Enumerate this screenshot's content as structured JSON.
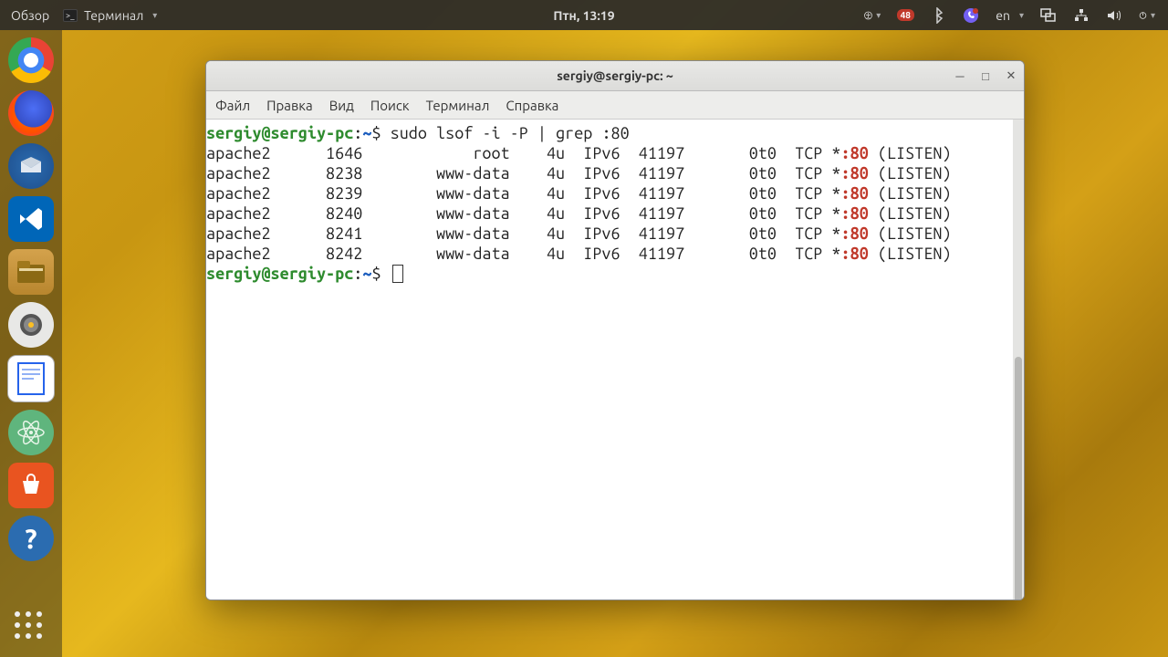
{
  "top_panel": {
    "activities": "Обзор",
    "app_menu": "Терминал",
    "clock": "Птн, 13:19",
    "lang": "en",
    "badge": "48"
  },
  "dock": {
    "items": [
      "chrome",
      "firefox",
      "thunderbird",
      "vscode",
      "files",
      "rhythmbox",
      "writer",
      "atom",
      "software",
      "help"
    ]
  },
  "window": {
    "title": "sergiy@sergiy-pc: ~",
    "menu": {
      "file": "Файл",
      "edit": "Правка",
      "view": "Вид",
      "search": "Поиск",
      "terminal": "Терминал",
      "help": "Справка"
    }
  },
  "terminal": {
    "prompt_user": "sergiy@sergiy-pc",
    "prompt_path": "~",
    "prompt_sep": ":",
    "prompt_dollar": "$",
    "command": "sudo lsof -i -P | grep :80",
    "rows": [
      {
        "proc": "apache2",
        "pid": "1646",
        "user": "root",
        "fd": "4u",
        "type": "IPv6",
        "node": "41197",
        "sz": "0t0",
        "proto": "TCP *",
        "port": ":80",
        "state": "(LISTEN)"
      },
      {
        "proc": "apache2",
        "pid": "8238",
        "user": "www-data",
        "fd": "4u",
        "type": "IPv6",
        "node": "41197",
        "sz": "0t0",
        "proto": "TCP *",
        "port": ":80",
        "state": "(LISTEN)"
      },
      {
        "proc": "apache2",
        "pid": "8239",
        "user": "www-data",
        "fd": "4u",
        "type": "IPv6",
        "node": "41197",
        "sz": "0t0",
        "proto": "TCP *",
        "port": ":80",
        "state": "(LISTEN)"
      },
      {
        "proc": "apache2",
        "pid": "8240",
        "user": "www-data",
        "fd": "4u",
        "type": "IPv6",
        "node": "41197",
        "sz": "0t0",
        "proto": "TCP *",
        "port": ":80",
        "state": "(LISTEN)"
      },
      {
        "proc": "apache2",
        "pid": "8241",
        "user": "www-data",
        "fd": "4u",
        "type": "IPv6",
        "node": "41197",
        "sz": "0t0",
        "proto": "TCP *",
        "port": ":80",
        "state": "(LISTEN)"
      },
      {
        "proc": "apache2",
        "pid": "8242",
        "user": "www-data",
        "fd": "4u",
        "type": "IPv6",
        "node": "41197",
        "sz": "0t0",
        "proto": "TCP *",
        "port": ":80",
        "state": "(LISTEN)"
      }
    ]
  }
}
